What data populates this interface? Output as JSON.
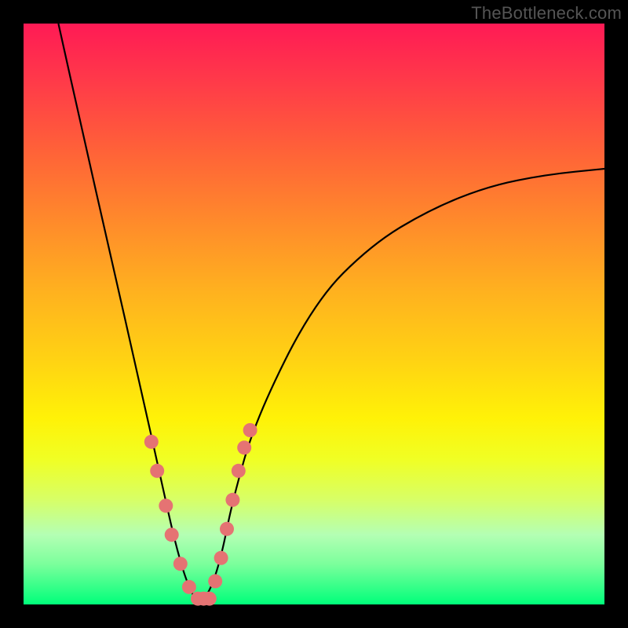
{
  "watermark": "TheBottleneck.com",
  "colors": {
    "frame": "#000000",
    "marker": "#e57373",
    "curve": "#000000",
    "gradient_top": "#ff1a55",
    "gradient_bottom": "#00ff7a"
  },
  "chart_data": {
    "type": "line",
    "title": "",
    "xlabel": "",
    "ylabel": "",
    "xlim": [
      0,
      100
    ],
    "ylim": [
      0,
      100
    ],
    "grid": false,
    "legend": false,
    "series": [
      {
        "name": "bottleneck-curve",
        "description": "V-shaped bottleneck curve; minimum near x≈30; y ranges 0–100 (mismatch %)",
        "x": [
          6,
          10,
          15,
          20,
          24,
          26,
          28,
          30,
          32,
          34,
          36,
          40,
          50,
          60,
          70,
          80,
          90,
          100
        ],
        "y": [
          100,
          82,
          60,
          38,
          20,
          11,
          4,
          0,
          2,
          8,
          18,
          32,
          52,
          62,
          68,
          72,
          74,
          75
        ],
        "minimum_x": 30,
        "minimum_y": 0
      }
    ],
    "markers": {
      "name": "highlighted-points",
      "description": "Pink beads near the valley of the curve",
      "points": [
        {
          "x": 22,
          "y": 28
        },
        {
          "x": 23,
          "y": 23
        },
        {
          "x": 24.5,
          "y": 17
        },
        {
          "x": 25.5,
          "y": 12
        },
        {
          "x": 27,
          "y": 7
        },
        {
          "x": 28.5,
          "y": 3
        },
        {
          "x": 30,
          "y": 1
        },
        {
          "x": 31,
          "y": 1
        },
        {
          "x": 32,
          "y": 1
        },
        {
          "x": 33,
          "y": 4
        },
        {
          "x": 34,
          "y": 8
        },
        {
          "x": 35,
          "y": 13
        },
        {
          "x": 36,
          "y": 18
        },
        {
          "x": 37,
          "y": 23
        },
        {
          "x": 38,
          "y": 27
        },
        {
          "x": 39,
          "y": 30
        }
      ]
    }
  }
}
